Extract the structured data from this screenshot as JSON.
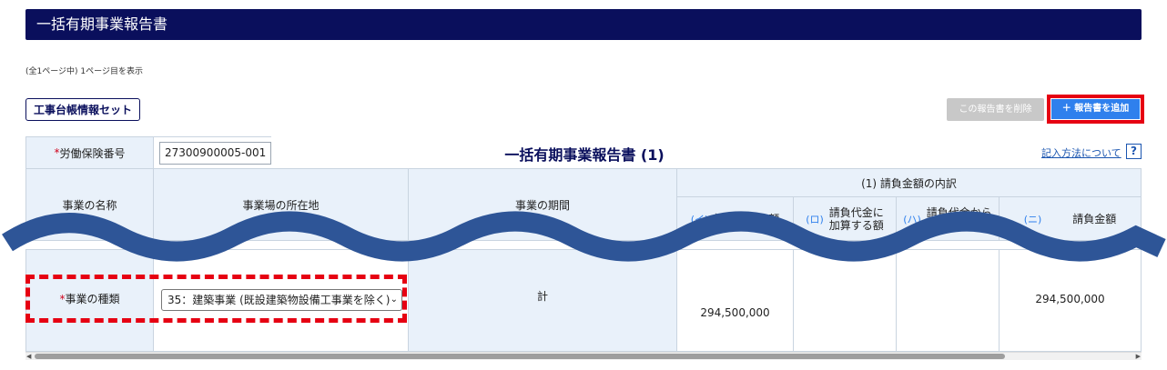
{
  "header": {
    "title": "一括有期事業報告書"
  },
  "page_info": "(全1ページ中) 1ページ目を表示",
  "toolbar": {
    "set_label": "工事台帳情報セット",
    "delete_label": "この報告書を削除",
    "add_label": "＋ 報告書を追加"
  },
  "form": {
    "required_mark": "*",
    "insurance_label": "労働保険番号",
    "insurance_value": "27300900005-001",
    "report_title": "一括有期事業報告書 (1)",
    "help_link": "記入方法について",
    "help_icon": "?"
  },
  "table": {
    "col_business_name": "事業の名称",
    "col_location": "事業場の所在地",
    "col_period": "事業の期間",
    "group_header": "(1) 請負金額の内訳",
    "sub_a_prefix": "(イ)",
    "sub_a_label": "請負代金の額",
    "sub_b_prefix": "(ロ)",
    "sub_b_label": "請負代金に\n加算する額",
    "sub_c_prefix": "(ハ)",
    "sub_c_label": "請負代金から\n控除する額",
    "sub_d_prefix": "(ニ)",
    "sub_d_label": "請負金額",
    "business_type_label": "事業の種類",
    "business_type_value": "35：建築事業 (既設建築物設備工事業を除く)",
    "total_label": "計",
    "amount_a": "294,500,000",
    "amount_d": "294,500,000"
  }
}
